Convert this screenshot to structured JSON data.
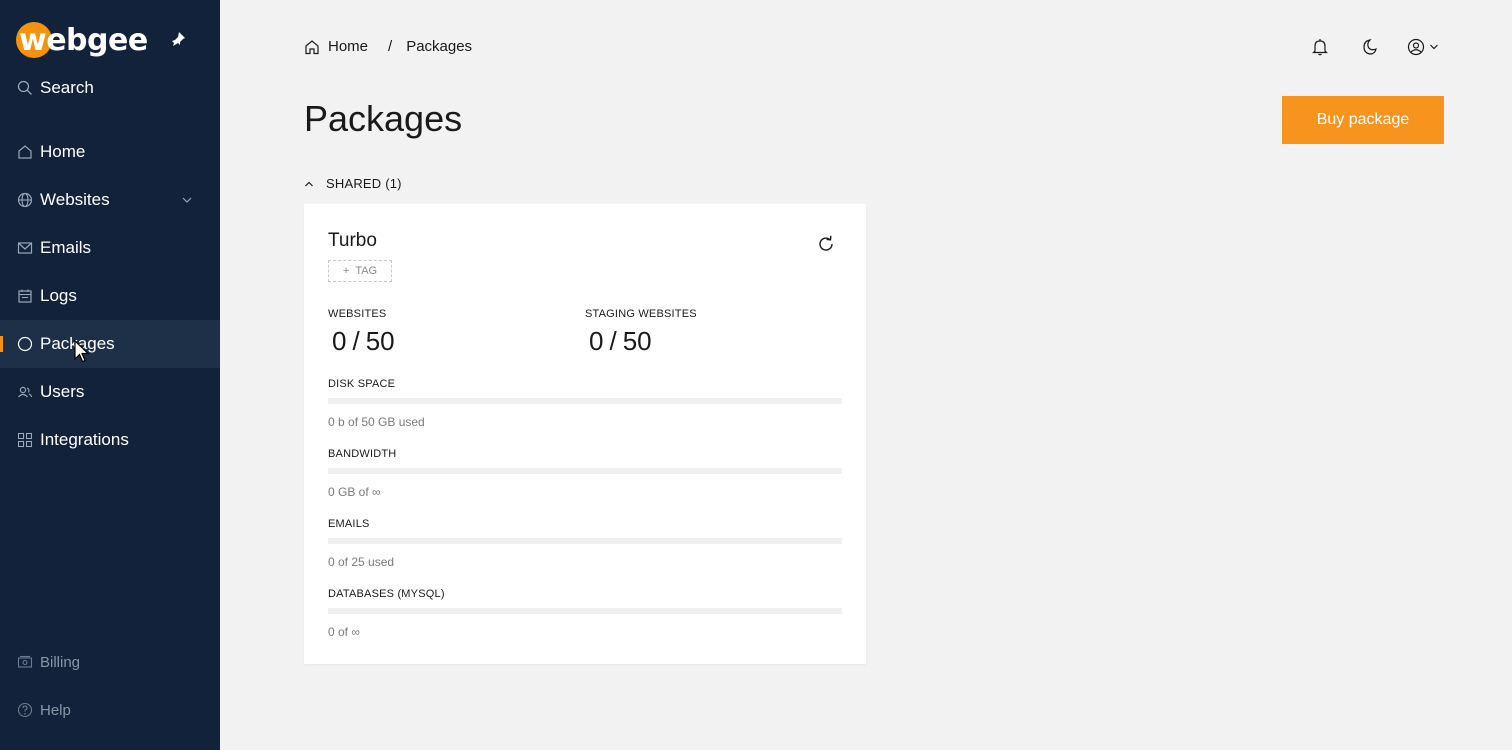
{
  "brand": {
    "name": "webgee",
    "accent": "#f5930f",
    "sidebar_bg": "#12223a"
  },
  "sidebar": {
    "search_label": "Search",
    "items": [
      {
        "label": "Home",
        "icon": "home-icon"
      },
      {
        "label": "Websites",
        "icon": "globe-icon"
      },
      {
        "label": "Emails",
        "icon": "mail-icon"
      },
      {
        "label": "Logs",
        "icon": "calendar-icon"
      },
      {
        "label": "Packages",
        "icon": "circle-icon"
      },
      {
        "label": "Users",
        "icon": "users-icon"
      },
      {
        "label": "Integrations",
        "icon": "grid-icon"
      }
    ],
    "footer": [
      {
        "label": "Billing",
        "icon": "billing-icon"
      },
      {
        "label": "Help",
        "icon": "help-icon"
      }
    ]
  },
  "breadcrumb": {
    "home": "Home",
    "separator": "/",
    "current": "Packages"
  },
  "page": {
    "title": "Packages",
    "buy_button": "Buy package"
  },
  "section": {
    "label": "SHARED (1)"
  },
  "package": {
    "name": "Turbo",
    "tag_button": "TAG",
    "websites": {
      "label": "WEBSITES",
      "used": "0",
      "slash": "/",
      "total": "50"
    },
    "staging": {
      "label": "STAGING WEBSITES",
      "used": "0",
      "slash": "/",
      "total": "50"
    },
    "resources": [
      {
        "label": "DISK SPACE",
        "text": "0 b of 50 GB used",
        "fill": 0
      },
      {
        "label": "BANDWIDTH",
        "text": "0 GB of ∞",
        "fill": 0
      },
      {
        "label": "EMAILS",
        "text": "0 of 25 used",
        "fill": 0
      },
      {
        "label": "DATABASES (MYSQL)",
        "text": "0 of ∞",
        "fill": 0
      }
    ]
  }
}
